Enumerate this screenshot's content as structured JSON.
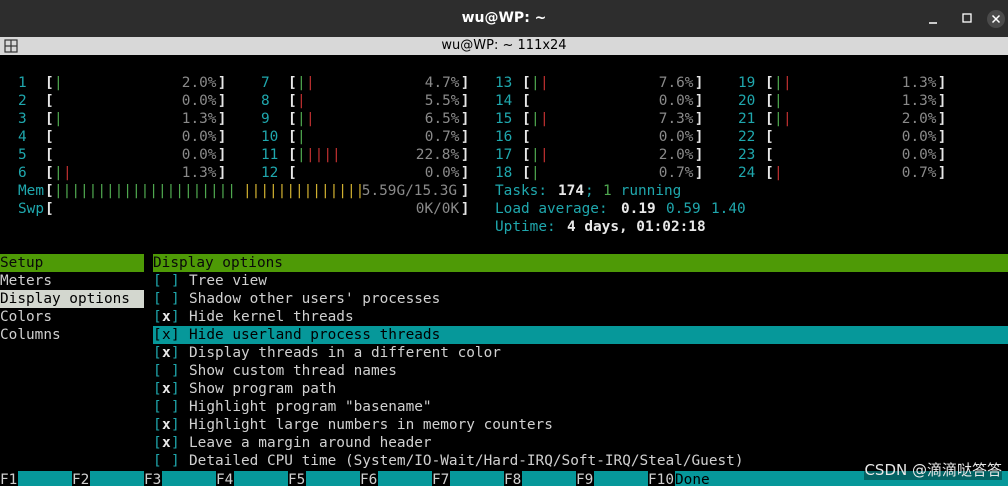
{
  "window": {
    "title": "wu@WP: ~",
    "tab_title": "wu@WP: ~ 111x24",
    "controls": [
      "minimize",
      "maximize",
      "close"
    ]
  },
  "cpus": [
    {
      "id": "1",
      "bars": [
        {
          "c": "green",
          "n": 1
        }
      ],
      "pct": "2.0%"
    },
    {
      "id": "2",
      "bars": [],
      "pct": "0.0%"
    },
    {
      "id": "3",
      "bars": [
        {
          "c": "green",
          "n": 1
        }
      ],
      "pct": "1.3%"
    },
    {
      "id": "4",
      "bars": [],
      "pct": "0.0%"
    },
    {
      "id": "5",
      "bars": [],
      "pct": "0.0%"
    },
    {
      "id": "6",
      "bars": [
        {
          "c": "green",
          "n": 1
        },
        {
          "c": "red",
          "n": 1
        }
      ],
      "pct": "1.3%"
    },
    {
      "id": "7",
      "bars": [
        {
          "c": "green",
          "n": 1
        },
        {
          "c": "red",
          "n": 1
        }
      ],
      "pct": "4.7%"
    },
    {
      "id": "8",
      "bars": [
        {
          "c": "red",
          "n": 1
        }
      ],
      "pct": "5.5%"
    },
    {
      "id": "9",
      "bars": [
        {
          "c": "green",
          "n": 1
        },
        {
          "c": "red",
          "n": 1
        }
      ],
      "pct": "6.5%"
    },
    {
      "id": "10",
      "bars": [
        {
          "c": "green",
          "n": 1
        }
      ],
      "pct": "0.7%"
    },
    {
      "id": "11",
      "bars": [
        {
          "c": "green",
          "n": 1
        },
        {
          "c": "red",
          "n": 4
        }
      ],
      "pct": "22.8%"
    },
    {
      "id": "12",
      "bars": [],
      "pct": "0.0%"
    },
    {
      "id": "13",
      "bars": [
        {
          "c": "green",
          "n": 1
        },
        {
          "c": "red",
          "n": 1
        }
      ],
      "pct": "7.6%"
    },
    {
      "id": "14",
      "bars": [],
      "pct": "0.0%"
    },
    {
      "id": "15",
      "bars": [
        {
          "c": "green",
          "n": 1
        },
        {
          "c": "red",
          "n": 1
        }
      ],
      "pct": "7.3%"
    },
    {
      "id": "16",
      "bars": [],
      "pct": "0.0%"
    },
    {
      "id": "17",
      "bars": [
        {
          "c": "green",
          "n": 1
        },
        {
          "c": "red",
          "n": 1
        }
      ],
      "pct": "2.0%"
    },
    {
      "id": "18",
      "bars": [
        {
          "c": "green",
          "n": 1
        }
      ],
      "pct": "0.7%"
    },
    {
      "id": "19",
      "bars": [
        {
          "c": "green",
          "n": 1
        },
        {
          "c": "red",
          "n": 1
        }
      ],
      "pct": "1.3%"
    },
    {
      "id": "20",
      "bars": [
        {
          "c": "green",
          "n": 1
        }
      ],
      "pct": "1.3%"
    },
    {
      "id": "21",
      "bars": [
        {
          "c": "green",
          "n": 1
        },
        {
          "c": "red",
          "n": 1
        }
      ],
      "pct": "2.0%"
    },
    {
      "id": "22",
      "bars": [],
      "pct": "0.0%"
    },
    {
      "id": "23",
      "bars": [],
      "pct": "0.0%"
    },
    {
      "id": "24",
      "bars": [
        {
          "c": "red",
          "n": 1
        }
      ],
      "pct": "0.7%"
    }
  ],
  "mem": {
    "label": "Mem",
    "bars": [
      {
        "c": "green",
        "n": 21
      },
      {
        "c": "yellow",
        "n": 14
      }
    ],
    "value": "5.59G/15.3G"
  },
  "swp": {
    "label": "Swp",
    "bars": [],
    "value": "0K/0K"
  },
  "tasks": {
    "label": "Tasks: ",
    "count": "174",
    "sep": "; ",
    "running": "1",
    "running_label": " running",
    "load_label": "Load average: ",
    "load1": "0.19",
    "load5": "0.59",
    "load15": "1.40",
    "uptime_label": "Uptime: ",
    "uptime": "4 days, 01:02:18"
  },
  "setup_menu": {
    "header": "Setup",
    "items": [
      "Meters",
      "Display options",
      "Colors",
      "Columns"
    ],
    "selected": "Display options"
  },
  "display_options": {
    "header": "Display options",
    "items": [
      {
        "label": "Tree view",
        "checked": false
      },
      {
        "label": "Shadow other users' processes",
        "checked": false
      },
      {
        "label": "Hide kernel threads",
        "checked": true
      },
      {
        "label": "Hide userland process threads",
        "checked": true,
        "highlighted": true
      },
      {
        "label": "Display threads in a different color",
        "checked": true
      },
      {
        "label": "Show custom thread names",
        "checked": false
      },
      {
        "label": "Show program path",
        "checked": true
      },
      {
        "label": "Highlight program \"basename\"",
        "checked": false
      },
      {
        "label": "Highlight large numbers in memory counters",
        "checked": true
      },
      {
        "label": "Leave a margin around header",
        "checked": true
      },
      {
        "label": "Detailed CPU time (System/IO-Wait/Hard-IRQ/Soft-IRQ/Steal/Guest)",
        "checked": false
      }
    ]
  },
  "fkeys": [
    {
      "key": "F1",
      "label": ""
    },
    {
      "key": "F2",
      "label": ""
    },
    {
      "key": "F3",
      "label": ""
    },
    {
      "key": "F4",
      "label": ""
    },
    {
      "key": "F5",
      "label": ""
    },
    {
      "key": "F6",
      "label": ""
    },
    {
      "key": "F7",
      "label": ""
    },
    {
      "key": "F8",
      "label": ""
    },
    {
      "key": "F9",
      "label": ""
    },
    {
      "key": "F10",
      "label": "Done"
    }
  ],
  "watermark": "CSDN @滴滴哒答答"
}
